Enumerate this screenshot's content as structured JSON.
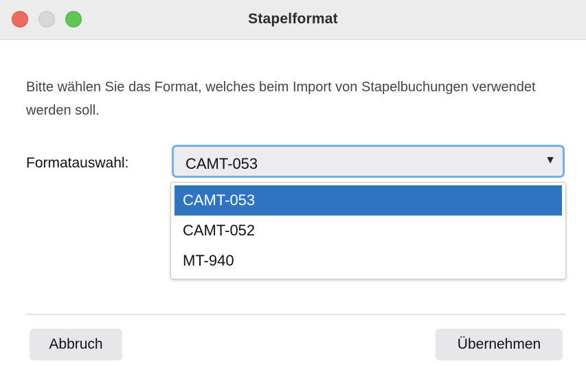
{
  "window": {
    "title": "Stapelformat"
  },
  "description": "Bitte wählen Sie das Format, welches beim Import von Stapelbuchungen verwendet werden soll.",
  "format": {
    "label": "Formatauswahl:",
    "selected": "CAMT-053",
    "arrow_icon": "▼",
    "options": [
      {
        "label": "CAMT-053",
        "selected": true
      },
      {
        "label": "CAMT-052",
        "selected": false
      },
      {
        "label": "MT-940",
        "selected": false
      }
    ]
  },
  "buttons": {
    "cancel": "Abbruch",
    "apply": "Übernehmen"
  },
  "colors": {
    "selection": "#2f74c0",
    "focus_ring": "#78aee6",
    "close": "#ed6a5e",
    "zoom": "#61c554"
  }
}
